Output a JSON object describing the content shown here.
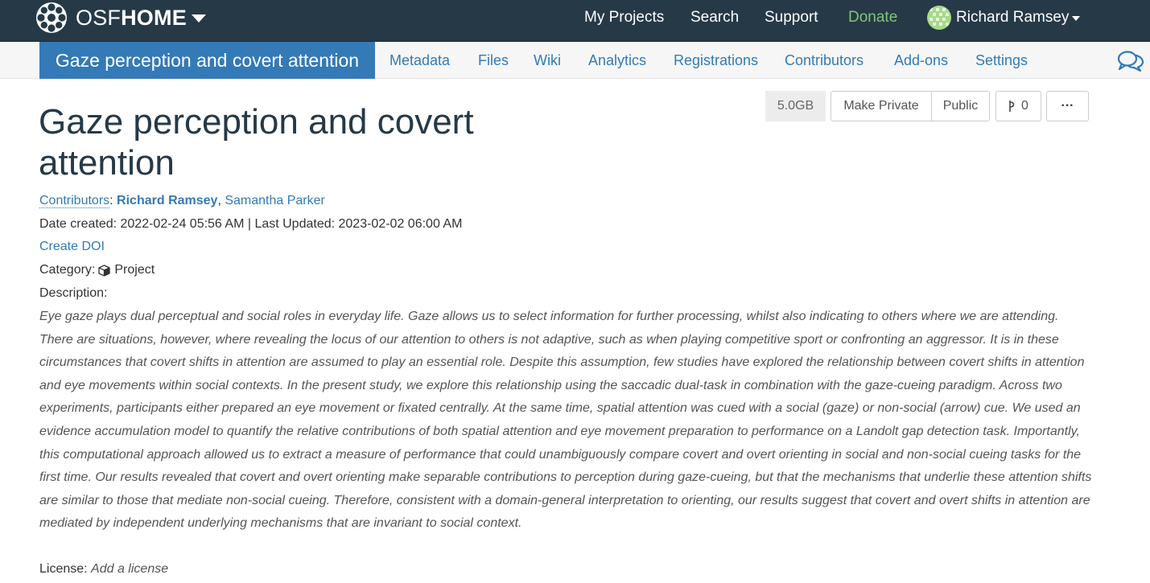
{
  "header": {
    "brand_light": "OSF",
    "brand_bold": "HOME",
    "nav": {
      "my_projects": "My Projects",
      "search": "Search",
      "support": "Support",
      "donate": "Donate"
    },
    "user_name": "Richard Ramsey",
    "colors": {
      "background": "#263947",
      "donate": "#7ec87a"
    }
  },
  "subnav": {
    "project_title": "Gaze perception and covert attention",
    "items": [
      "Metadata",
      "Files",
      "Wiki",
      "Analytics",
      "Registrations",
      "Contributors",
      "Add-ons",
      "Settings"
    ],
    "colors": {
      "active": "#337ab7"
    }
  },
  "actions": {
    "storage": "5.0GB",
    "make_private": "Make Private",
    "public": "Public",
    "fork_count": "0",
    "more": "···"
  },
  "project": {
    "title": "Gaze perception and covert attention",
    "contributors_label": "Contributors",
    "contributors": [
      "Richard Ramsey",
      "Samantha Parker"
    ],
    "date_line": "Date created: 2022-02-24 05:56 AM | Last Updated: 2023-02-02 06:00 AM",
    "create_doi": "Create DOI",
    "category_label": "Category:",
    "category_value": "Project",
    "description_label": "Description:",
    "description": "Eye gaze plays dual perceptual and social roles in everyday life. Gaze allows us to select information for further processing, whilst also indicating to others where we are attending. There are situations, however, where revealing the locus of our attention to others is not adaptive, such as when playing competitive sport or confronting an aggressor. It is in these circumstances that covert shifts in attention are assumed to play an essential role. Despite this assumption, few studies have explored the relationship between covert shifts in attention and eye movements within social contexts. In the present study, we explore this relationship using the saccadic dual-task in combination with the gaze-cueing paradigm. Across two experiments, participants either prepared an eye movement or fixated centrally. At the same time, spatial attention was cued with a social (gaze) or non-social (arrow) cue. We used an evidence accumulation model to quantify the relative contributions of both spatial attention and eye movement preparation to performance on a Landolt gap detection task. Importantly, this computational approach allowed us to extract a measure of performance that could unambiguously compare covert and overt orienting in social and non-social cueing tasks for the first time. Our results revealed that covert and overt orienting make separable contributions to perception during gaze-cueing, but that the mechanisms that underlie these attention shifts are similar to those that mediate non-social cueing. Therefore, consistent with a domain-general interpretation to orienting, our results suggest that covert and overt shifts in attention are mediated by independent underlying mechanisms that are invariant to social context.",
    "license_label": "License:",
    "license_value": "Add a license"
  },
  "icons": [
    "osf-logo-icon",
    "caret-down-icon",
    "avatar-icon",
    "chat-bubbles-icon",
    "fork-icon",
    "cube-icon"
  ]
}
